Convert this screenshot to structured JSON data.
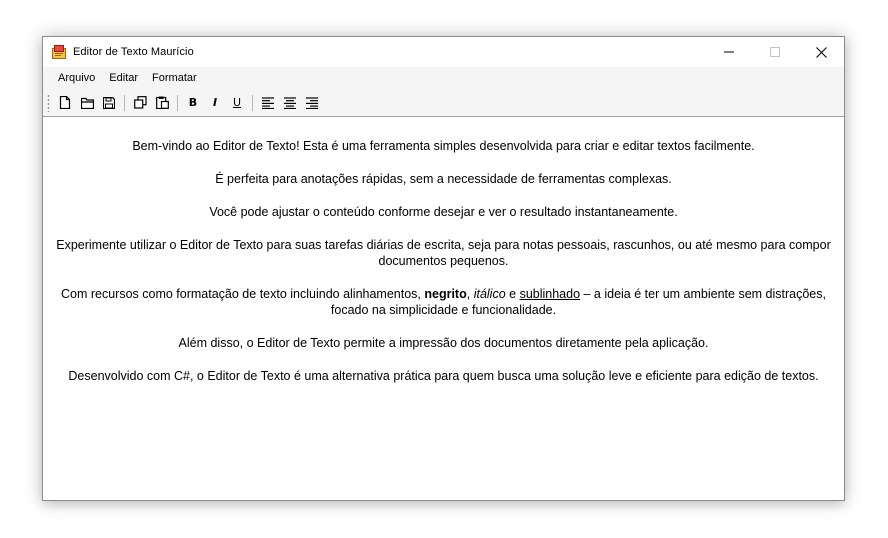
{
  "window": {
    "title": "Editor de Texto Maurício",
    "controls": {
      "minimize": "minimize-icon",
      "maximize": "maximize-icon",
      "close": "close-icon"
    }
  },
  "menu": {
    "items": [
      {
        "label": "Arquivo"
      },
      {
        "label": "Editar"
      },
      {
        "label": "Formatar"
      }
    ]
  },
  "toolbar": {
    "file_icons": [
      "new-document-icon",
      "open-folder-icon",
      "save-icon"
    ],
    "clip_icons": [
      "copy-icon",
      "paste-icon"
    ],
    "bold": "B",
    "italic": "I",
    "underline": "U",
    "align_icons": [
      "align-left-icon",
      "align-center-icon",
      "align-right-icon"
    ]
  },
  "document": {
    "p1": "Bem-vindo ao Editor de Texto! Esta é uma ferramenta simples desenvolvida para criar e editar textos facilmente.",
    "p2": "É perfeita para anotações rápidas, sem a necessidade de ferramentas complexas.",
    "p3": "Você pode ajustar o conteúdo conforme desejar e ver o resultado instantaneamente.",
    "p4": "Experimente utilizar o Editor de Texto para suas tarefas diárias de escrita, seja para notas pessoais, rascunhos, ou até mesmo para compor documentos pequenos.",
    "p5": {
      "a": "Com recursos como formatação de texto incluindo alinhamentos, ",
      "bold": "negrito",
      "b": ", ",
      "italic": "itálico",
      "c": " e ",
      "underline": "sublinhado",
      "d": " – a ideia é ter um ambiente sem distrações, focado na simplicidade e funcionalidade."
    },
    "p6": "Além disso, o Editor de Texto permite a impressão dos documentos diretamente pela aplicação.",
    "p7": "Desenvolvido com C#, o Editor de Texto é uma alternativa prática para quem busca uma solução leve e eficiente para edição de textos."
  }
}
